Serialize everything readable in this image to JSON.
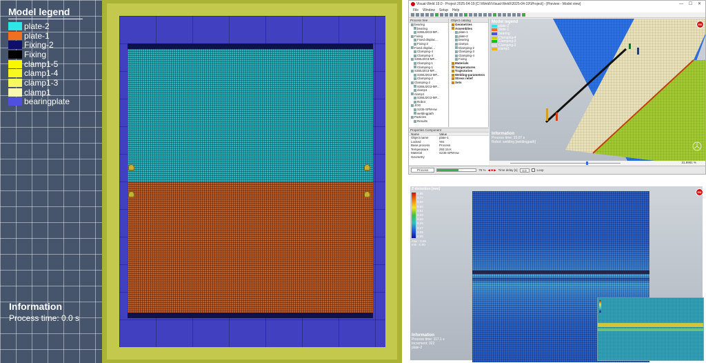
{
  "left_view": {
    "legend_title": "Model legend",
    "legend": [
      {
        "label": "plate-2",
        "color": "#2ee6e6"
      },
      {
        "label": "plate-1",
        "color": "#f07020"
      },
      {
        "label": "Fixing-2",
        "color": "#10106a"
      },
      {
        "label": "Fixing",
        "color": "#000000"
      },
      {
        "label": "clamp1-5",
        "color": "#f8f800"
      },
      {
        "label": "clamp1-4",
        "color": "#f8f820"
      },
      {
        "label": "clamp1-3",
        "color": "#f8f860"
      },
      {
        "label": "clamp1",
        "color": "#f8f8b0"
      },
      {
        "label": "bearingplate",
        "color": "#5050e0"
      }
    ],
    "info_title": "Information",
    "info_text": "Process time: 0.0 s"
  },
  "app": {
    "title": "Visual-Weld 19.0 - Project 2025-04-19 [C:\\\\Weld\\\\Visual-Weld\\\\2025-04-19\\\\Project] - [Preview - Model view]",
    "menu": [
      "File",
      "Window",
      "Setup",
      "Help"
    ],
    "tree_header": "Process tree",
    "tree": [
      {
        "text": "bearing",
        "bold": false
      },
      {
        "text": "bearing",
        "bold": false
      },
      {
        "text": "S355J2G3-MF...",
        "bold": false
      },
      {
        "text": "Fixing",
        "bold": false
      },
      {
        "text": "Fixed displac...",
        "bold": false
      },
      {
        "text": "Fixing-2",
        "bold": false
      },
      {
        "text": "Fixed displac...",
        "bold": false
      },
      {
        "text": "Clamping-4",
        "bold": false
      },
      {
        "text": "Clamping-4",
        "bold": false
      },
      {
        "text": "S355J2G3-MF...",
        "bold": false
      },
      {
        "text": "Clamping-1",
        "bold": false
      },
      {
        "text": "Clamping-1",
        "bold": false
      },
      {
        "text": "S355J2G3-MF...",
        "bold": false
      },
      {
        "text": "S355J2G3-MF...",
        "bold": false
      },
      {
        "text": "Clamping-2",
        "bold": false
      },
      {
        "text": "Clamping-2",
        "bold": false
      },
      {
        "text": "S355J2G3-MF...",
        "bold": false
      },
      {
        "text": "clamp1",
        "bold": false
      },
      {
        "text": "clamp1",
        "bold": false
      },
      {
        "text": "S355J2G3-MF...",
        "bold": false
      },
      {
        "text": "Robot",
        "bold": false
      },
      {
        "text": "JOG",
        "bold": false
      },
      {
        "text": "S235-SPM-sw",
        "bold": false
      },
      {
        "text": "weldingpath",
        "bold": false
      },
      {
        "text": "Particles",
        "bold": false
      },
      {
        "text": "Results",
        "bold": false
      }
    ],
    "catalog_header": "Object catalog",
    "catalog": [
      {
        "text": "Geometries",
        "bold": true
      },
      {
        "text": "Assemblies",
        "bold": true
      },
      {
        "text": "plate-1",
        "bold": false
      },
      {
        "text": "plate-2",
        "bold": false
      },
      {
        "text": "bearing",
        "bold": false
      },
      {
        "text": "clamp1",
        "bold": false
      },
      {
        "text": "Clamping-2",
        "bold": false
      },
      {
        "text": "Clamping-3",
        "bold": false
      },
      {
        "text": "Clamping-4",
        "bold": false
      },
      {
        "text": "Fixing",
        "bold": false
      },
      {
        "text": "Materials",
        "bold": true
      },
      {
        "text": "Temperatures",
        "bold": true
      },
      {
        "text": "Trajectories",
        "bold": true
      },
      {
        "text": "Welding-parameters",
        "bold": true
      },
      {
        "text": "Stress relief",
        "bold": true
      },
      {
        "text": "Sets",
        "bold": true
      }
    ],
    "props_header": "Properties  Component",
    "props_cols": [
      "Name",
      "Value"
    ],
    "props": [
      {
        "k": "Object name",
        "v": "plate-1"
      },
      {
        "k": "Locked",
        "v": "Yes"
      },
      {
        "k": "Base process",
        "v": "Process"
      },
      {
        "k": "Temperature",
        "v": "293.15 K"
      },
      {
        "k": "Material",
        "v": "S235-SPM-sw"
      },
      {
        "k": "Geometry",
        "v": ""
      }
    ],
    "status": {
      "process_label": "Process",
      "progress_fraction": 0.55,
      "percent": "76 %",
      "time_delay_label": "Time delay [s]",
      "time_delay_value": "0.0",
      "loop_label": "Loop"
    },
    "view3d": {
      "legend_title": "Model legend",
      "legend": [
        {
          "label": "plate-2",
          "color": "#2ee6e6"
        },
        {
          "label": "plate-1",
          "color": "#f07020"
        },
        {
          "label": "bearing",
          "color": "#5050e0"
        },
        {
          "label": "Clamping-4",
          "color": "#d0d000"
        },
        {
          "label": "Clamping-3",
          "color": "#10c020"
        },
        {
          "label": "Clamping-2",
          "color": "#e0e0e0"
        },
        {
          "label": "clamp1",
          "color": "#f0b020"
        }
      ],
      "info_title": "Information",
      "info_lines": [
        "Process time: 15.07 s",
        "Robot: welding [weldingpath]"
      ],
      "zoom": "31.8981 %",
      "logo": "ESI"
    }
  },
  "result_view": {
    "legend_title": "Z distortion [mm]",
    "ticks": [
      "0.85",
      "0.77",
      "0.68",
      "0.60",
      "0.51",
      "0.43",
      "0.34",
      "0.26",
      "0.17",
      "0.09",
      "0.00"
    ],
    "minmax": [
      "max : 0.85",
      "min : 0.00"
    ],
    "info_title": "Information",
    "info_lines": [
      "Process time: 117.1 s",
      "Increment: 322",
      "plate-2"
    ],
    "logo": "ESI"
  }
}
